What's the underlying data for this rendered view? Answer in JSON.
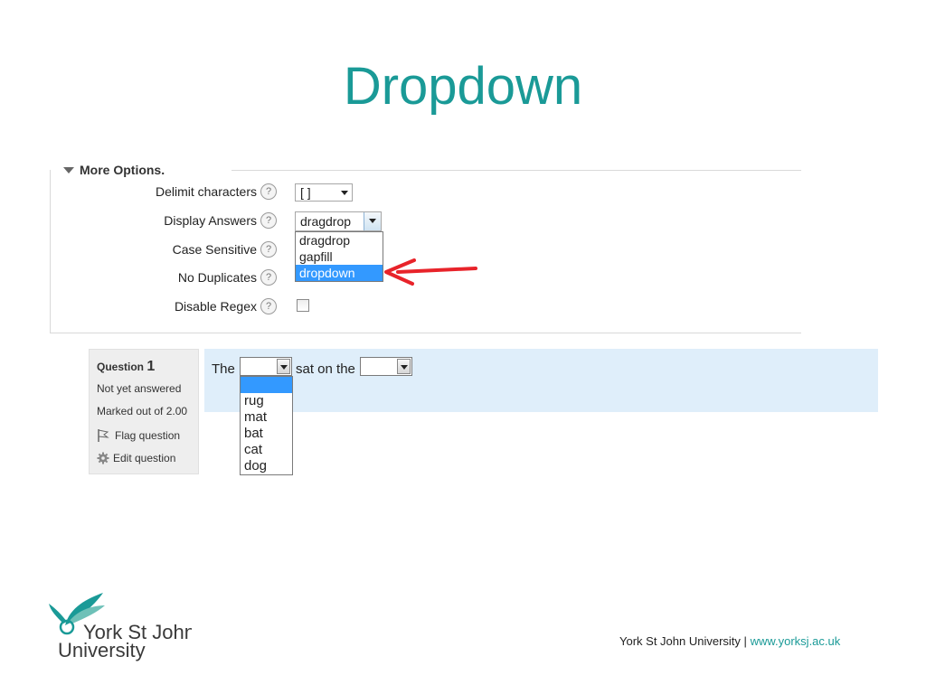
{
  "title": "Dropdown",
  "more_options": {
    "legend": "More Options.",
    "rows": [
      {
        "label": "Delimit characters"
      },
      {
        "label": "Display Answers"
      },
      {
        "label": "Case Sensitive"
      },
      {
        "label": "No Duplicates"
      },
      {
        "label": "Disable Regex"
      }
    ],
    "delimit_value": "[ ]",
    "display_value": "dragdrop",
    "display_options": [
      "dragdrop",
      "gapfill",
      "dropdown"
    ],
    "highlighted_option": "dropdown",
    "help_glyph": "?",
    "arrow_color": "#e8232a"
  },
  "question": {
    "label": "Question",
    "number": "1",
    "status": "Not yet answered",
    "marked": "Marked out of 2.00",
    "flag": "Flag question",
    "edit": "Edit question",
    "text_parts": [
      "The",
      "sat on the"
    ],
    "dropdown_options": [
      "",
      "rug",
      "mat",
      "bat",
      "cat",
      "dog"
    ]
  },
  "footer": {
    "university": "York St John University",
    "separator": "|",
    "url": "www.yorksj.ac.uk"
  },
  "logo": {
    "line1": "York St John",
    "line2": "University"
  },
  "colors": {
    "accent": "#1a9a97",
    "highlight": "#3399ff",
    "question_bg": "#dfeefa"
  }
}
